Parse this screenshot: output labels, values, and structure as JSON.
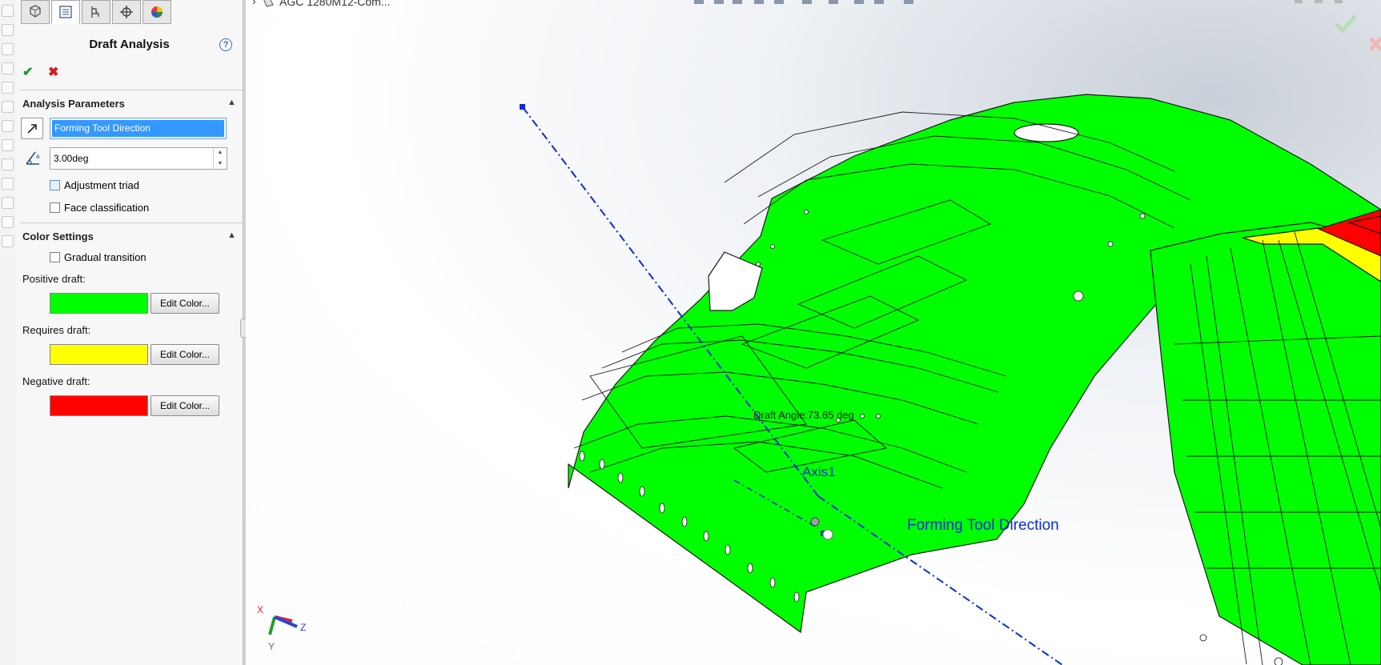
{
  "feature": {
    "title": "Draft Analysis",
    "help_symbol": "?",
    "ok_symbol": "✔",
    "cancel_symbol": "✖"
  },
  "tabs": [
    {
      "name": "feature-manager"
    },
    {
      "name": "property-manager"
    },
    {
      "name": "configuration-manager"
    },
    {
      "name": "dimxpert-manager"
    },
    {
      "name": "display-manager"
    }
  ],
  "analysis_parameters": {
    "header": "Analysis Parameters",
    "direction_value": "Forming Tool Direction",
    "angle_value": "3.00deg",
    "adjustment_triad_label": "Adjustment triad",
    "adjustment_triad_checked": false,
    "face_classification_label": "Face classification",
    "face_classification_checked": false
  },
  "color_settings": {
    "header": "Color Settings",
    "gradual_transition_label": "Gradual transition",
    "gradual_transition_checked": false,
    "positive_label": "Positive draft:",
    "positive_color": "#00ff00",
    "requires_label": "Requires draft:",
    "requires_color": "#ffff00",
    "negative_label": "Negative draft:",
    "negative_color": "#ff0000",
    "edit_button_label": "Edit Color..."
  },
  "viewport": {
    "document_title": "AGC 1280M12-Com...",
    "draft_angle_label": "Draft Angle:73.65 deg",
    "axis_label": "Axis1",
    "direction_label": "Forming Tool Direction",
    "triad_x": "X",
    "triad_y": "Y",
    "triad_z": "Z"
  }
}
